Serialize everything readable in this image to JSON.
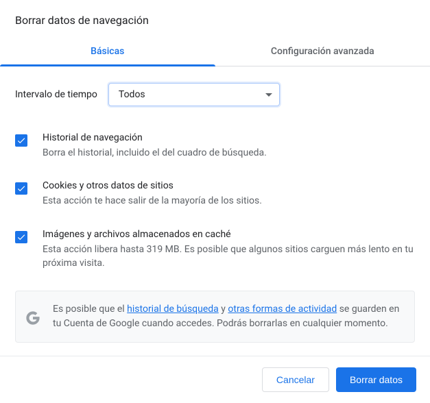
{
  "title": "Borrar datos de navegación",
  "tabs": {
    "basic": "Básicas",
    "advanced": "Configuración avanzada"
  },
  "time": {
    "label": "Intervalo de tiempo",
    "selected": "Todos"
  },
  "options": {
    "history": {
      "title": "Historial de navegación",
      "desc": "Borra el historial, incluido el del cuadro de búsqueda.",
      "checked": true
    },
    "cookies": {
      "title": "Cookies y otros datos de sitios",
      "desc": "Esta acción te hace salir de la mayoría de los sitios.",
      "checked": true
    },
    "cache": {
      "title": "Imágenes y archivos almacenados en caché",
      "desc": "Esta acción libera hasta 319 MB. Es posible que algunos sitios carguen más lento en tu próxima visita.",
      "checked": true
    }
  },
  "notice": {
    "pre": "Es posible que el ",
    "link1": "historial de búsqueda",
    "mid": " y ",
    "link2": "otras formas de actividad",
    "post": " se guarden en tu Cuenta de Google cuando accedes. Podrás borrarlas en cualquier momento."
  },
  "buttons": {
    "cancel": "Cancelar",
    "clear": "Borrar datos"
  }
}
